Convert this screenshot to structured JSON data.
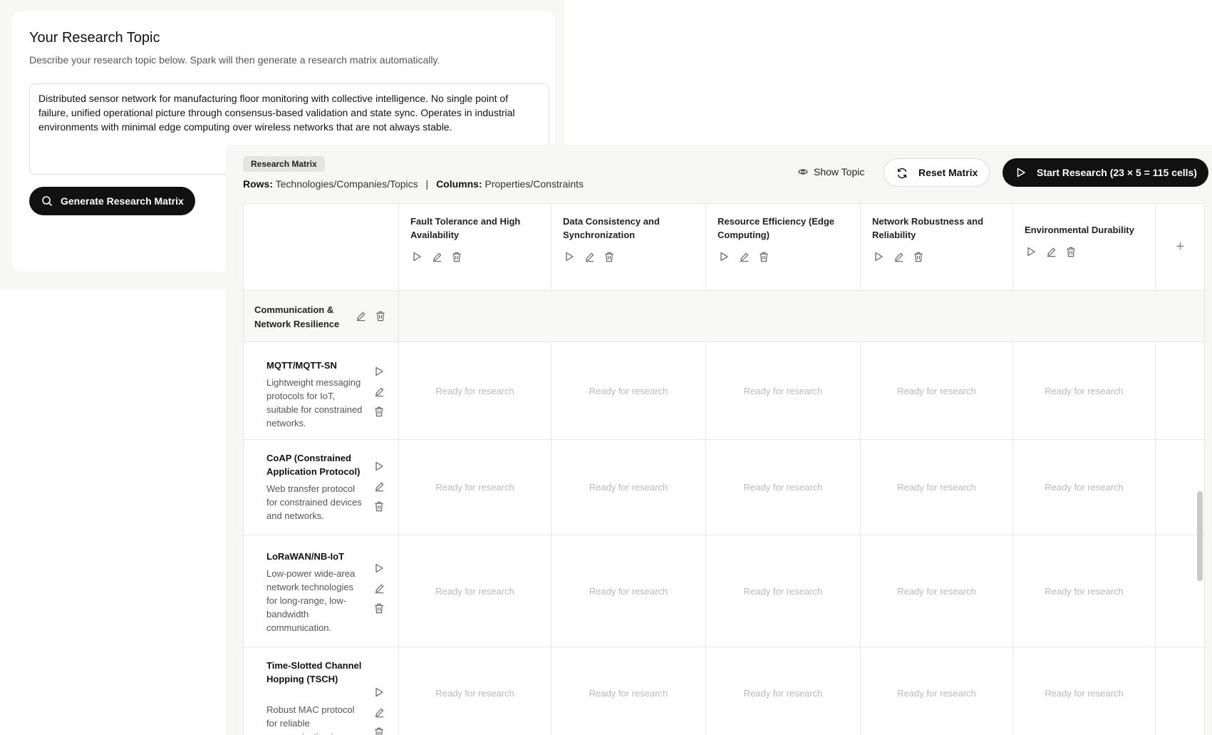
{
  "topic": {
    "title": "Your Research Topic",
    "description": "Describe your research topic below. Spark will then generate a research matrix automatically.",
    "text": "Distributed sensor network for manufacturing floor monitoring with collective intelligence. No single point of failure, unified operational picture through consensus-based validation and state sync. Operates in industrial environments with minimal edge computing over wireless networks that are not always stable.",
    "generate_label": "Generate Research Matrix"
  },
  "matrix": {
    "badge": "Research Matrix",
    "rows_label": "Rows:",
    "rows_value": "Technologies/Companies/Topics",
    "separator": "|",
    "cols_label": "Columns:",
    "cols_value": "Properties/Constraints",
    "show_topic_label": "Show Topic",
    "reset_label": "Reset Matrix",
    "start_label": "Start Research (23 × 5 = 115 cells)",
    "add_column_symbol": "+",
    "columns": [
      "Fault Tolerance and High Availability",
      "Data Consistency and Synchronization",
      "Resource Efficiency (Edge Computing)",
      "Network Robustness and Reliability",
      "Environmental Durability"
    ],
    "group": "Communication & Network Resilience",
    "rows": [
      {
        "name": "MQTT/MQTT-SN",
        "description": "Lightweight messaging protocols for IoT, suitable for constrained networks."
      },
      {
        "name": "CoAP (Constrained Application Protocol)",
        "description": "Web transfer protocol for constrained devices and networks."
      },
      {
        "name": "LoRaWAN/NB-IoT",
        "description": "Low-power wide-area network technologies for long-range, low-bandwidth communication."
      },
      {
        "name": "Time-Slotted Channel Hopping (TSCH)",
        "description": "Robust MAC protocol for reliable communication in"
      }
    ],
    "cell_status": "Ready for research"
  },
  "icons": {
    "search": "search-icon",
    "eye": "eye-icon",
    "refresh": "refresh-icon",
    "play": "play-icon",
    "edit": "pencil-icon",
    "delete": "trash-icon",
    "add": "plus-icon"
  }
}
